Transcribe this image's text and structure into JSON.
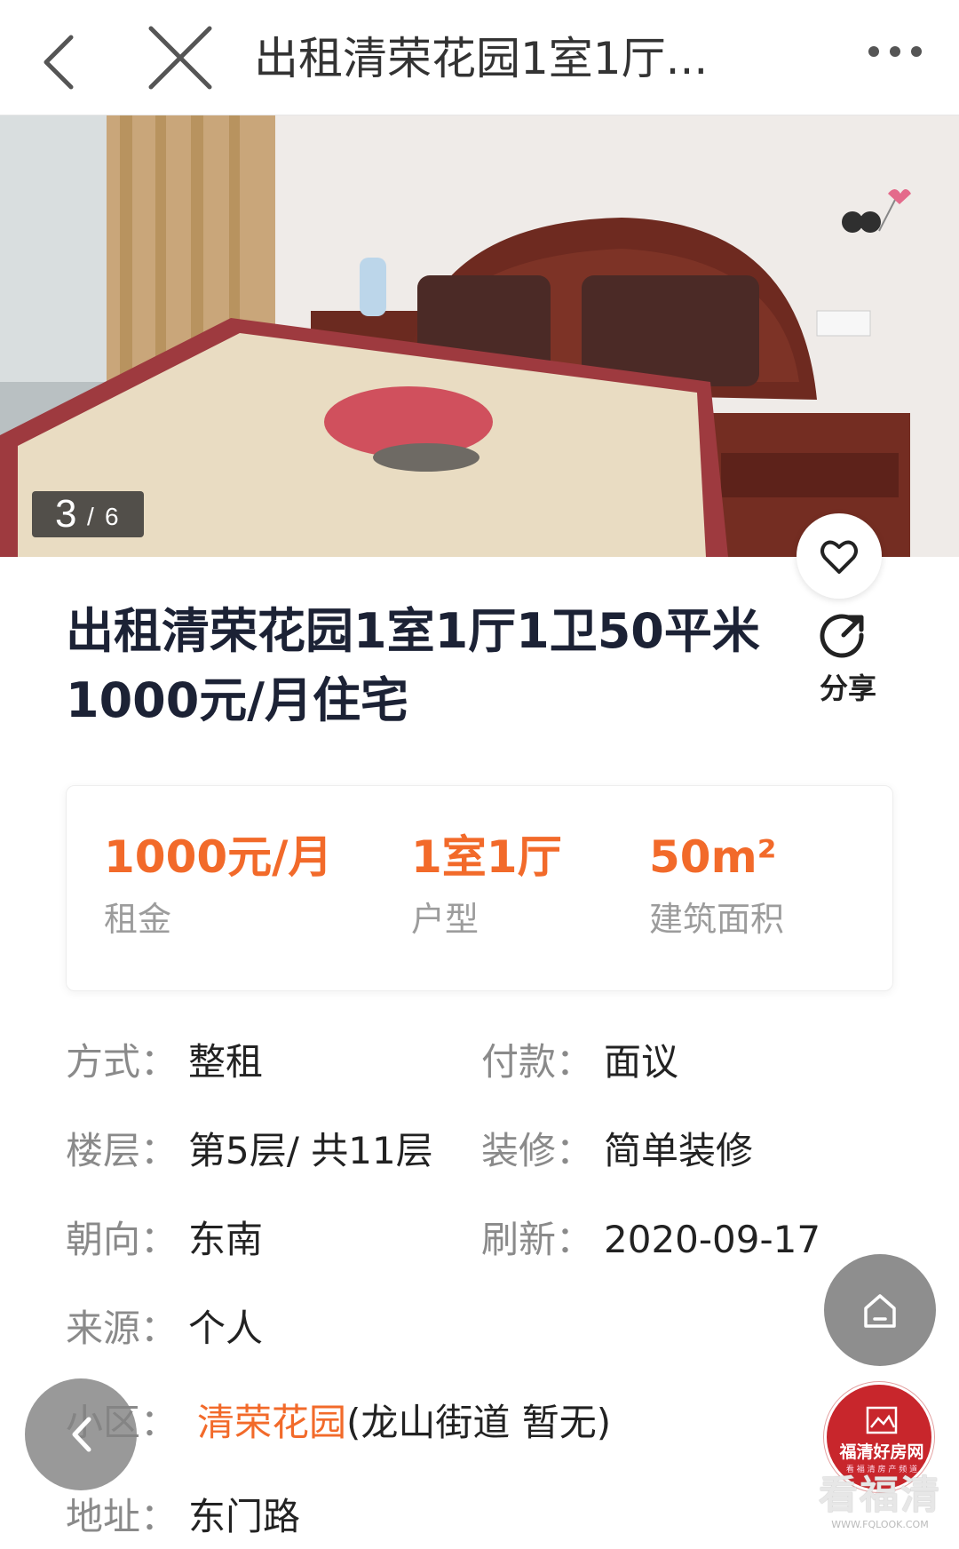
{
  "nav": {
    "title": "出租清荣花园1室1厅..."
  },
  "icons": {
    "back": "chevron-left-icon",
    "close": "close-icon",
    "more": "more-dots-icon",
    "favorite": "heart-icon",
    "share": "share-icon",
    "home": "home-icon"
  },
  "gallery": {
    "current": "3",
    "separator": "/",
    "total": "6"
  },
  "listing": {
    "title": "出租清荣花园1室1厅1卫50平米1000元/月住宅",
    "share_label": "分享"
  },
  "stats": {
    "rent_value": "1000元/月",
    "rent_label": "租金",
    "layout_value": "1室1厅",
    "layout_label": "户型",
    "area_value": "50m²",
    "area_label": "建筑面积"
  },
  "details": {
    "mode_label": "方式：",
    "mode_value": "整租",
    "payment_label": "付款：",
    "payment_value": "面议",
    "floor_label": "楼层：",
    "floor_value": "第5层/ 共11层",
    "decor_label": "装修：",
    "decor_value": "简单装修",
    "orientation_label": "朝向：",
    "orientation_value": "东南",
    "refresh_label": "刷新：",
    "refresh_value": "2020-09-17",
    "source_label": "来源：",
    "source_value": "个人",
    "community_label": "小区：",
    "community_link": "清荣花园",
    "community_extra": "(龙山街道 暂无)",
    "address_label": "地址：",
    "address_value": "东门路"
  },
  "branding": {
    "logo_text": "福清好房网",
    "logo_sub": "看 福 清 房 产 频 道",
    "watermark": "看福清",
    "watermark_url": "WWW.FQLOOK.COM"
  },
  "colors": {
    "accent": "#f26a2a",
    "title": "#1c2235",
    "label": "#8a8a8a",
    "brand_red": "#c8262c"
  }
}
